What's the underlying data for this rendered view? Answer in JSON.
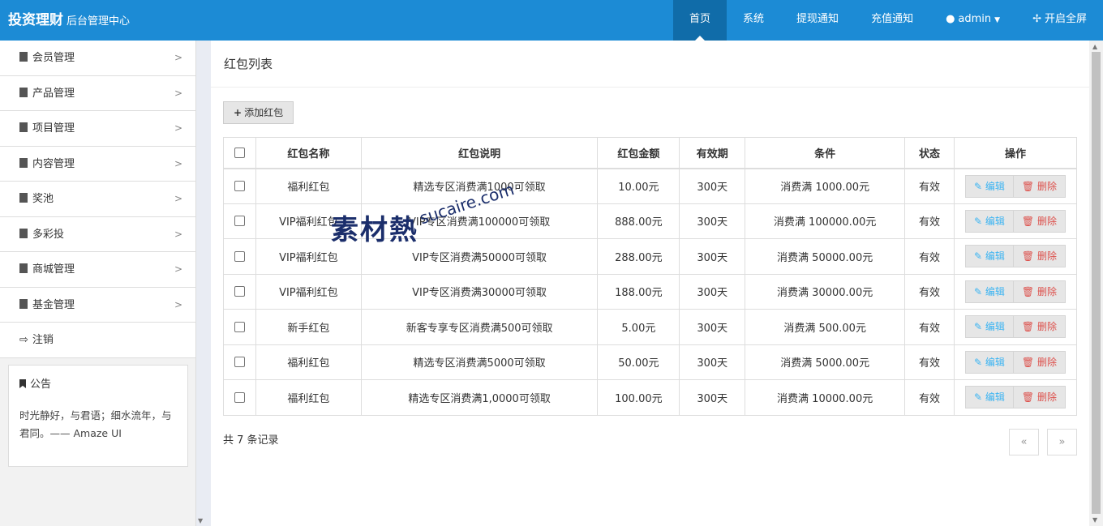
{
  "brand": {
    "title": "投资理财",
    "subtitle": "后台管理中心"
  },
  "nav": {
    "home": "首页",
    "system": "系统",
    "withdraw": "提现通知",
    "recharge": "充值通知",
    "user": "admin",
    "fullscreen": "开启全屏"
  },
  "sidebar": {
    "items": [
      {
        "label": "会员管理"
      },
      {
        "label": "产品管理"
      },
      {
        "label": "项目管理"
      },
      {
        "label": "内容管理"
      },
      {
        "label": "奖池"
      },
      {
        "label": "多彩投"
      },
      {
        "label": "商城管理"
      },
      {
        "label": "基金管理"
      }
    ],
    "logout": "注销",
    "notice": {
      "title": "公告",
      "text": "时光静好，与君语；细水流年，与君同。—— Amaze UI"
    }
  },
  "main": {
    "title": "红包列表",
    "add_label": "添加红包",
    "columns": [
      "红包名称",
      "红包说明",
      "红包金额",
      "有效期",
      "条件",
      "状态",
      "操作"
    ],
    "rows": [
      {
        "name": "福利红包",
        "desc": "精选专区消费满1000可领取",
        "amount": "10.00元",
        "validity": "300天",
        "condition": "消费满 1000.00元",
        "status": "有效"
      },
      {
        "name": "VIP福利红包",
        "desc": "VIP专区消费满100000可领取",
        "amount": "888.00元",
        "validity": "300天",
        "condition": "消费满 100000.00元",
        "status": "有效"
      },
      {
        "name": "VIP福利红包",
        "desc": "VIP专区消费满50000可领取",
        "amount": "288.00元",
        "validity": "300天",
        "condition": "消费满 50000.00元",
        "status": "有效"
      },
      {
        "name": "VIP福利红包",
        "desc": "VIP专区消费满30000可领取",
        "amount": "188.00元",
        "validity": "300天",
        "condition": "消费满 30000.00元",
        "status": "有效"
      },
      {
        "name": "新手红包",
        "desc": "新客专享专区消费满500可领取",
        "amount": "5.00元",
        "validity": "300天",
        "condition": "消费满 500.00元",
        "status": "有效"
      },
      {
        "name": "福利红包",
        "desc": "精选专区消费满5000可领取",
        "amount": "50.00元",
        "validity": "300天",
        "condition": "消费满 5000.00元",
        "status": "有效"
      },
      {
        "name": "福利红包",
        "desc": "精选专区消费满1,0000可领取",
        "amount": "100.00元",
        "validity": "300天",
        "condition": "消费满 10000.00元",
        "status": "有效"
      }
    ],
    "edit_label": "编辑",
    "delete_label": "删除",
    "records": "共 7 条记录",
    "prev": "«",
    "next": "»"
  },
  "watermark": {
    "main": "素材熱",
    "sub": "sucaire.com"
  },
  "colors": {
    "topbar": "#1c8bd5",
    "nav_active": "#106ca9",
    "edit": "#3bb4f2",
    "delete": "#dd514c"
  }
}
